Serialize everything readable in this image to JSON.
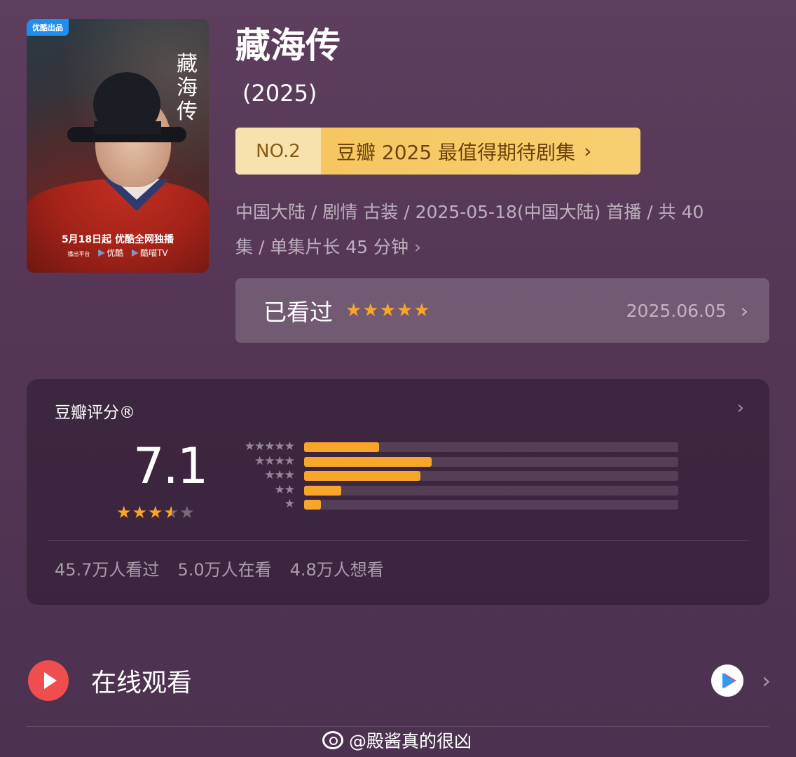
{
  "poster": {
    "badge": "优酷出品",
    "vertical_title": "藏海传",
    "release": "5月18日起 优酷全网独播",
    "platform_prefix": "播出平台",
    "platform_1": "优酷",
    "platform_2": "酷喵TV"
  },
  "title": "藏海传",
  "year": "(2025)",
  "rank": {
    "number": "NO.2",
    "text": "豆瓣 2025 最值得期待剧集"
  },
  "meta": {
    "line1": "中国大陆 / 剧情 古装 / 2025-05-18(中国大陆) 首播 / 共 40",
    "line2": "集 / 单集片长 45 分钟"
  },
  "my_status": {
    "label": "已看过",
    "stars": "★★★★★",
    "my_rating": 5,
    "date": "2025.06.05"
  },
  "rating": {
    "heading": "豆瓣评分®",
    "score": "7.1",
    "stars_value": 3.5,
    "counts": {
      "watched": "45.7万人看过",
      "watching": "5.0万人在看",
      "wish": "4.8万人想看"
    }
  },
  "chart_data": {
    "type": "bar",
    "categories": [
      "★★★★★",
      "★★★★",
      "★★★",
      "★★",
      "★"
    ],
    "values": [
      20.0,
      34.0,
      31.0,
      10.0,
      4.5
    ],
    "ylim": [
      0,
      100
    ]
  },
  "watch_online": {
    "label": "在线观看"
  },
  "watermark": "@殿酱真的很凶",
  "colors": {
    "accent_orange": "#f7a62a",
    "rank_bg": "#f6c45b",
    "play_red": "#f04e4e"
  }
}
